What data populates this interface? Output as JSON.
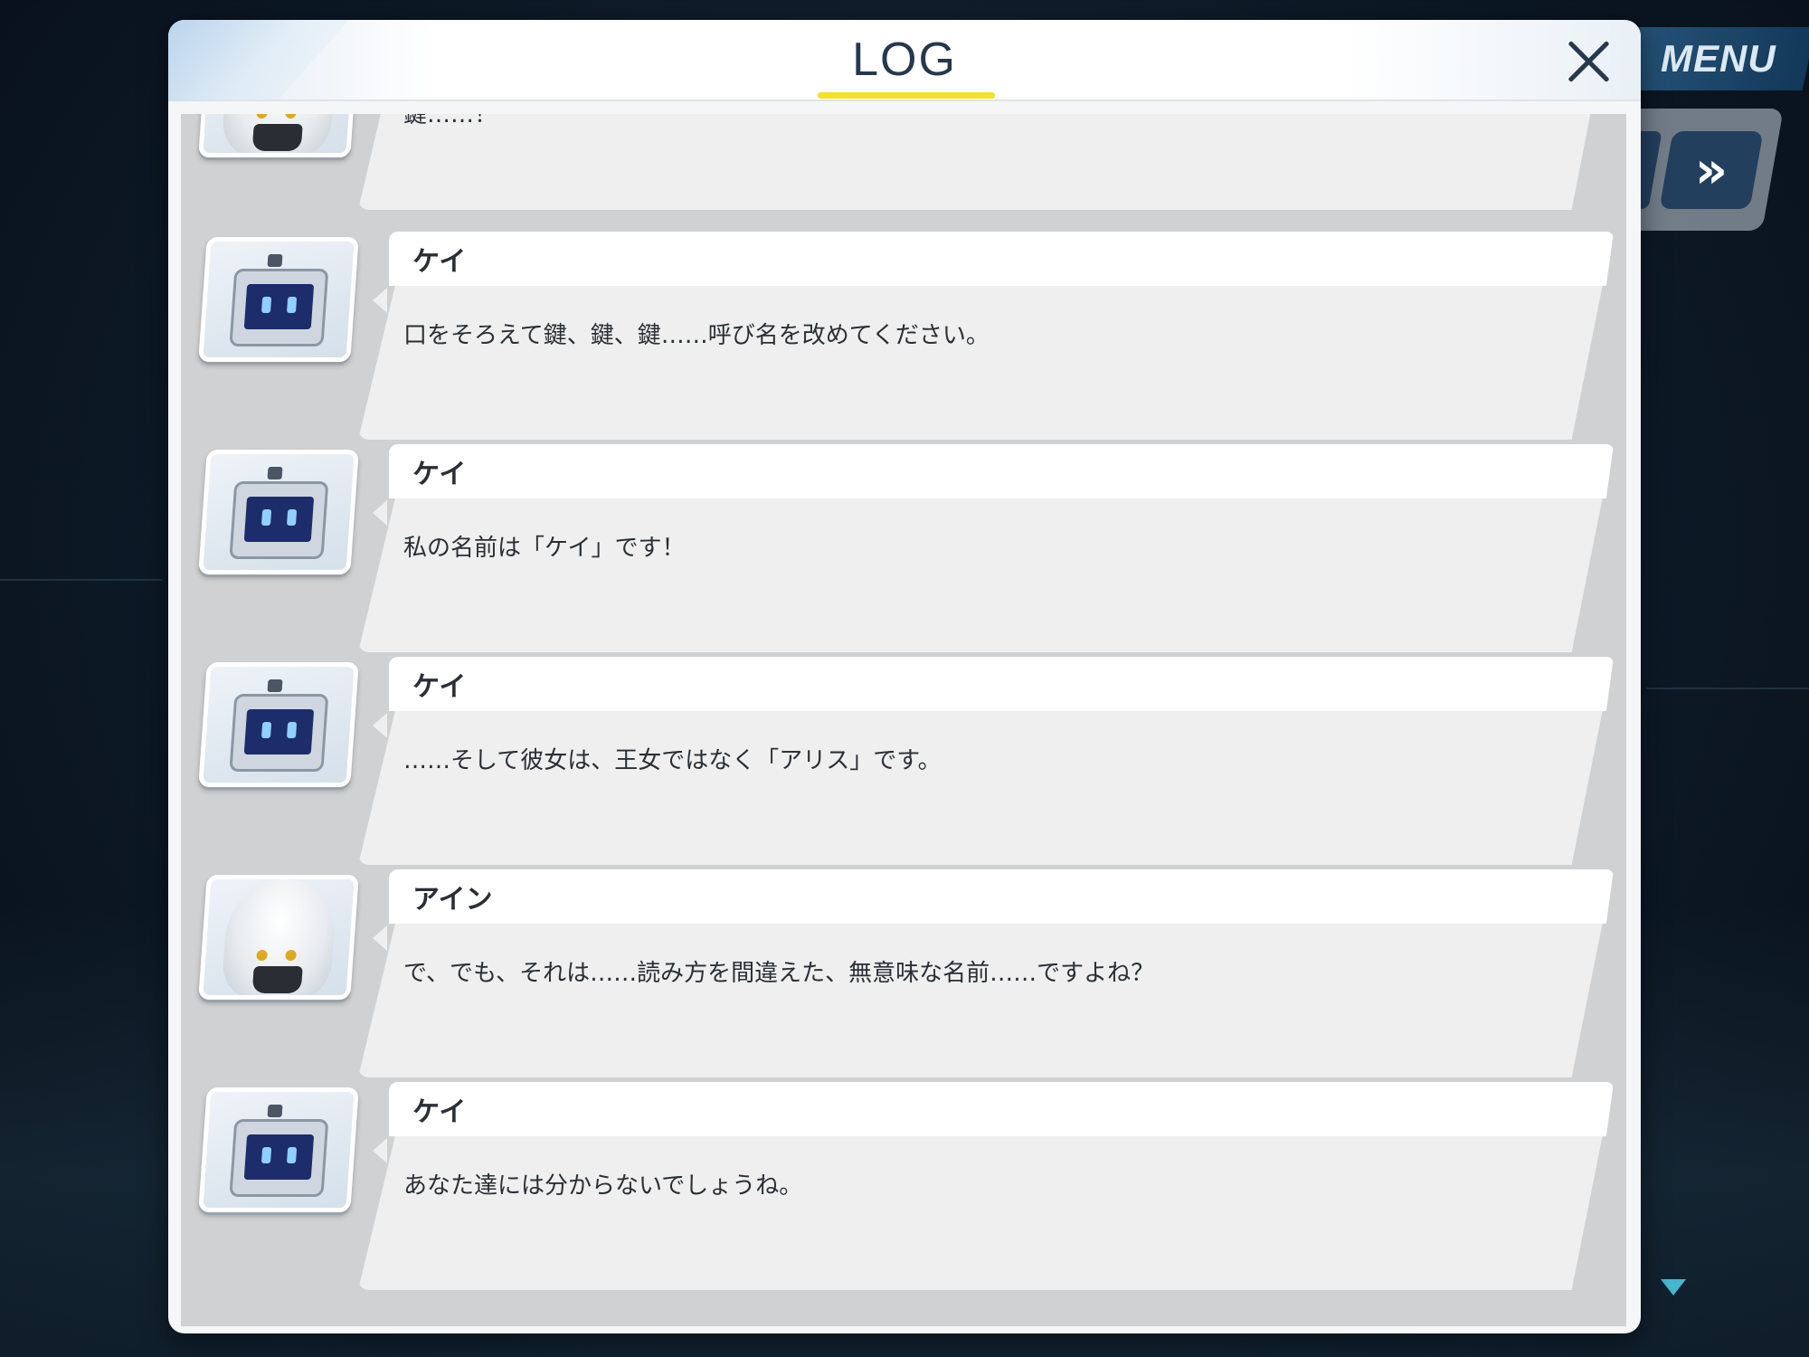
{
  "window": {
    "title": "LOG",
    "close_label": "×"
  },
  "hud": {
    "menu_label": "MENU",
    "auto_label": "»"
  },
  "entries": [
    {
      "speaker": "",
      "portrait": "ain",
      "text": "鍵……！"
    },
    {
      "speaker": "ケイ",
      "portrait": "kei",
      "text": "口をそろえて鍵、鍵、鍵……呼び名を改めてください。"
    },
    {
      "speaker": "ケイ",
      "portrait": "kei",
      "text": "私の名前は「ケイ」です！"
    },
    {
      "speaker": "ケイ",
      "portrait": "kei",
      "text": "……そして彼女は、王女ではなく「アリス」です。"
    },
    {
      "speaker": "アイン",
      "portrait": "ain",
      "text": "で、でも、それは……読み方を間違えた、無意味な名前……ですよね？"
    },
    {
      "speaker": "ケイ",
      "portrait": "kei",
      "text": "あなた達には分からないでしょうね。"
    }
  ],
  "colors": {
    "accent": "#f3e12c",
    "title": "#26384e",
    "scroll_arrow": "#45b7cf"
  }
}
